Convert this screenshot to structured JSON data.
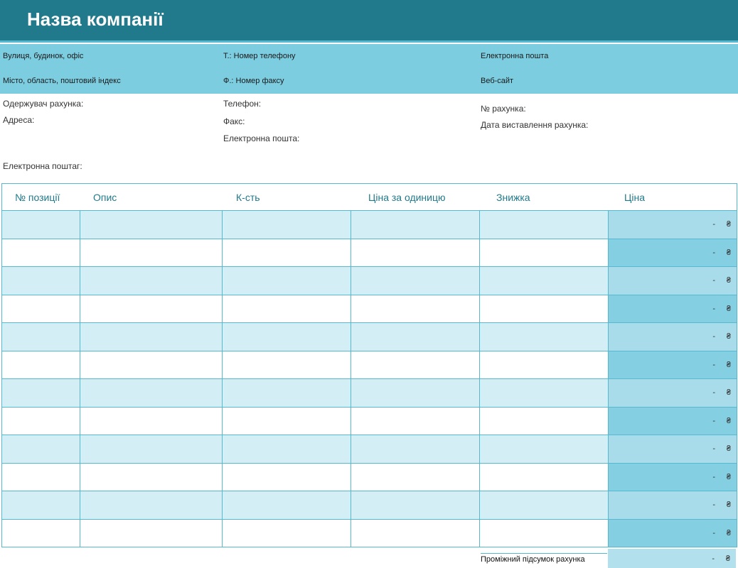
{
  "company": {
    "name": "Назва компанії"
  },
  "contact": {
    "street": "Вулиця, будинок, офіс",
    "city": "Місто, область, поштовий індекс",
    "phone": "Т.: Номер телефону",
    "fax": "Ф.: Номер факсу",
    "email": "Електронна пошта",
    "website": "Веб-сайт"
  },
  "billing": {
    "recipient_label": "Одержувач рахунка:",
    "address_label": "Адреса:",
    "email_label": "Електронна поштаг:",
    "phone_label": "Телефон:",
    "fax_label": "Факс:",
    "email2_label": "Електронна пошта:",
    "invoice_no_label": "№ рахунка:",
    "invoice_date_label": "Дата виставлення рахунка:"
  },
  "table": {
    "headers": [
      "№ позиції",
      "Опис",
      "К-сть",
      "Ціна за одиницю",
      "Знижка",
      "Ціна"
    ],
    "rows": [
      {
        "price": "-",
        "currency": "₴"
      },
      {
        "price": "-",
        "currency": "₴"
      },
      {
        "price": "-",
        "currency": "₴"
      },
      {
        "price": "-",
        "currency": "₴"
      },
      {
        "price": "-",
        "currency": "₴"
      },
      {
        "price": "-",
        "currency": "₴"
      },
      {
        "price": "-",
        "currency": "₴"
      },
      {
        "price": "-",
        "currency": "₴"
      },
      {
        "price": "-",
        "currency": "₴"
      },
      {
        "price": "-",
        "currency": "₴"
      },
      {
        "price": "-",
        "currency": "₴"
      },
      {
        "price": "-",
        "currency": "₴"
      }
    ]
  },
  "subtotal": {
    "label": "Проміжний підсумок рахунка",
    "value": "-",
    "currency": "₴"
  },
  "colors": {
    "title_bg": "#217a8b",
    "band_bg": "#7dcde0",
    "row_alt": "#d3eef5",
    "border": "#56b9cf"
  }
}
